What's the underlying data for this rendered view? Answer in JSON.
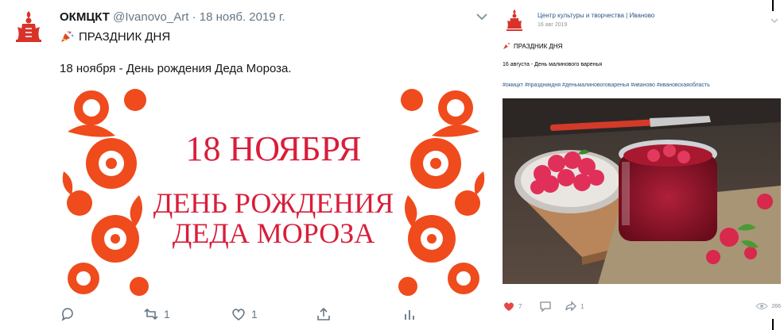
{
  "twitter_post": {
    "name": "ОКМЦКТ",
    "handle": "@Ivanovo_Art",
    "separator": "·",
    "date": "18 нояб. 2019 г.",
    "tagline": "ПРАЗДНИК ДНЯ",
    "text": "18 ноября - День рождения Деда Мороза.",
    "image_headline": "18 НОЯБРЯ",
    "image_sub_line1": "ДЕНЬ РОЖДЕНИЯ",
    "image_sub_line2": "ДЕДА МОРОЗА",
    "retweet_count": "1",
    "like_count": "1",
    "accent_color": "#d81e3a",
    "ornament_color": "#ef4b1c"
  },
  "vk_post": {
    "group_name": "Центр культуры и творчества | Иваново",
    "date": "16 авг 2019",
    "tagline": "ПРАЗДНИК ДНЯ",
    "text": "16 августа - День малинового варенья",
    "hashtags": "#окмцкт #праздникдня #деньмалиновоговаренья #иваново #ивановскаяобласть",
    "like_count": "7",
    "share_count": "1",
    "views": "266",
    "accent_color": "#e64646"
  }
}
